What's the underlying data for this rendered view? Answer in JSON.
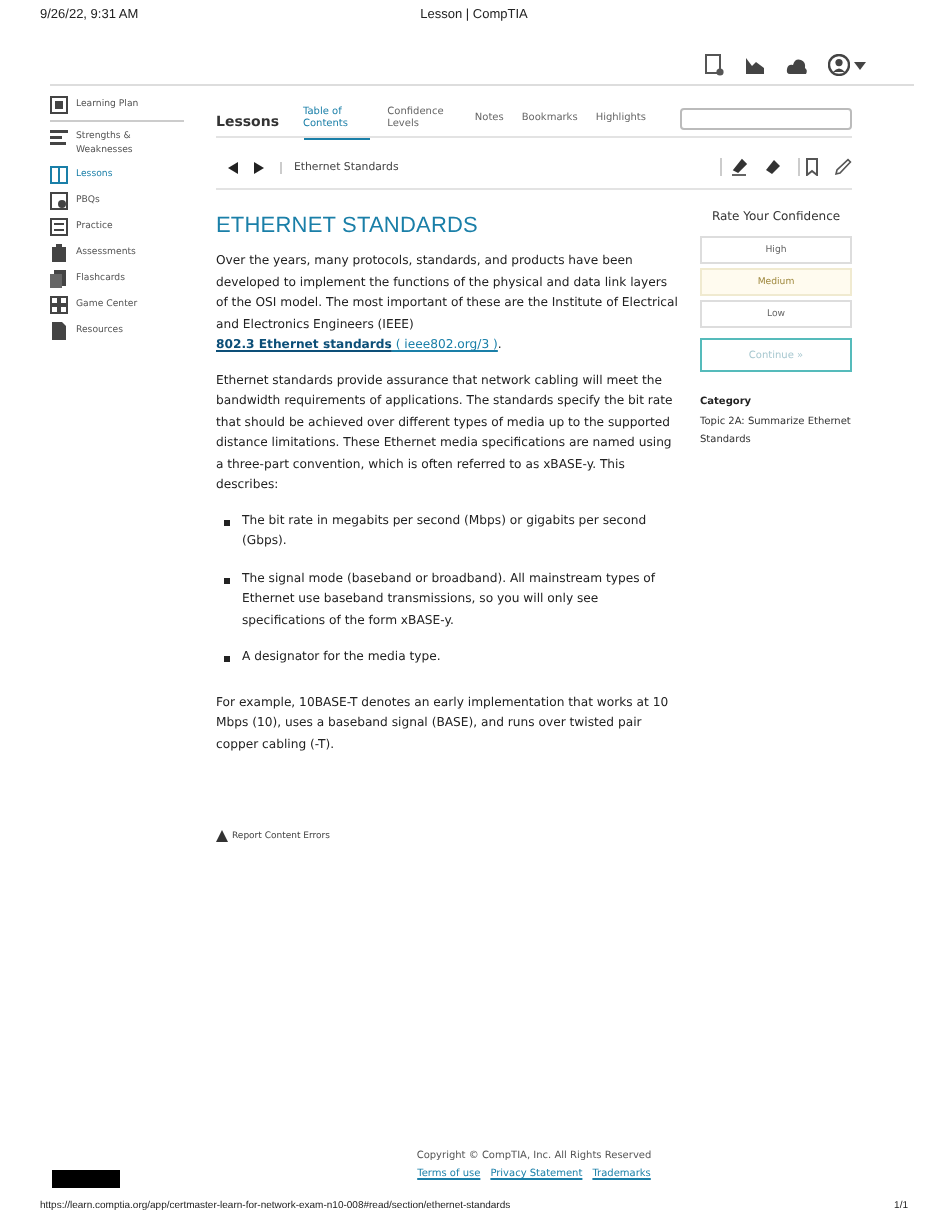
{
  "print_header": {
    "date": "9/26/22, 9:31 AM",
    "title": "Lesson | CompTIA"
  },
  "sidebar": {
    "items": [
      {
        "label": "Learning Plan",
        "selected": false
      },
      {
        "label": "Strengths & Weaknesses",
        "selected": false
      },
      {
        "label": "Lessons",
        "selected": true
      },
      {
        "label": "PBQs",
        "selected": false
      },
      {
        "label": "Practice",
        "selected": false
      },
      {
        "label": "Assessments",
        "selected": false
      },
      {
        "label": "Flashcards",
        "selected": false
      },
      {
        "label": "Game Center",
        "selected": false
      },
      {
        "label": "Resources",
        "selected": false
      }
    ]
  },
  "lessons_bar": {
    "title": "Lessons",
    "tabs": [
      {
        "label": "Table of Contents",
        "selected": true
      },
      {
        "label": "Confidence Levels",
        "selected": false
      },
      {
        "label": "Notes",
        "selected": false
      },
      {
        "label": "Bookmarks",
        "selected": false
      },
      {
        "label": "Highlights",
        "selected": false
      }
    ]
  },
  "breadcrumb": "Ethernet Standards",
  "article": {
    "heading": "ETHERNET STANDARDS",
    "blocks": [
      {
        "kind": "paragraph",
        "segments": [
          {
            "kind": "text",
            "text": "Over the years, many protocols, standards, and products have been developed to implement the functions of the physical and data link layers of the OSI model. The most important of these are the Institute of Electrical and Electronics Engineers (IEEE) "
          },
          {
            "kind": "strong-link",
            "text": "802.3 Ethernet standards"
          },
          {
            "kind": "link",
            "text": " ( ieee802.org/3 )"
          },
          {
            "kind": "text",
            "text": "."
          }
        ]
      },
      {
        "kind": "paragraph",
        "segments": [
          {
            "kind": "text",
            "text": "Ethernet standards provide assurance that network cabling will meet the bandwidth requirements of applications. The standards specify the bit rate that should be achieved over different types of media up to the supported distance limitations. These Ethernet media specifications are named using a three-part convention, which is often referred to as xBASE-y. This describes:"
          }
        ]
      },
      {
        "kind": "list",
        "items": [
          "The bit rate in megabits per second (Mbps) or gigabits per second (Gbps).",
          "The signal mode (baseband or broadband). All mainstream types of Ethernet use baseband transmissions, so you will only see specifications of the form xBASE-y.",
          "A designator for the media type."
        ]
      },
      {
        "kind": "paragraph",
        "segments": [
          {
            "kind": "text",
            "text": "For example, 10BASE-T denotes an early implementation that works at 10 Mbps (10), uses a baseband signal (BASE), and runs over twisted pair copper cabling (-T)."
          }
        ]
      }
    ],
    "report_link": "Report Content Errors"
  },
  "confidence": {
    "title": "Rate Your Confidence",
    "options": [
      {
        "label": "High",
        "selected": false
      },
      {
        "label": "Medium",
        "selected": true
      },
      {
        "label": "Low",
        "selected": false
      }
    ],
    "continue": {
      "label": "Continue »",
      "disabled": true
    },
    "category_label": "Category",
    "category": "Topic 2A: Summarize Ethernet Standards"
  },
  "footer": {
    "copyright": "Copyright © CompTIA, Inc. All Rights Reserved",
    "links": [
      "Terms of use",
      "Privacy Statement",
      "Trademarks"
    ]
  },
  "print_footer": {
    "url": "https://learn.comptia.org/app/certmaster-learn-for-network-exam-n10-008#read/section/ethernet-standards",
    "page": "1/1"
  }
}
